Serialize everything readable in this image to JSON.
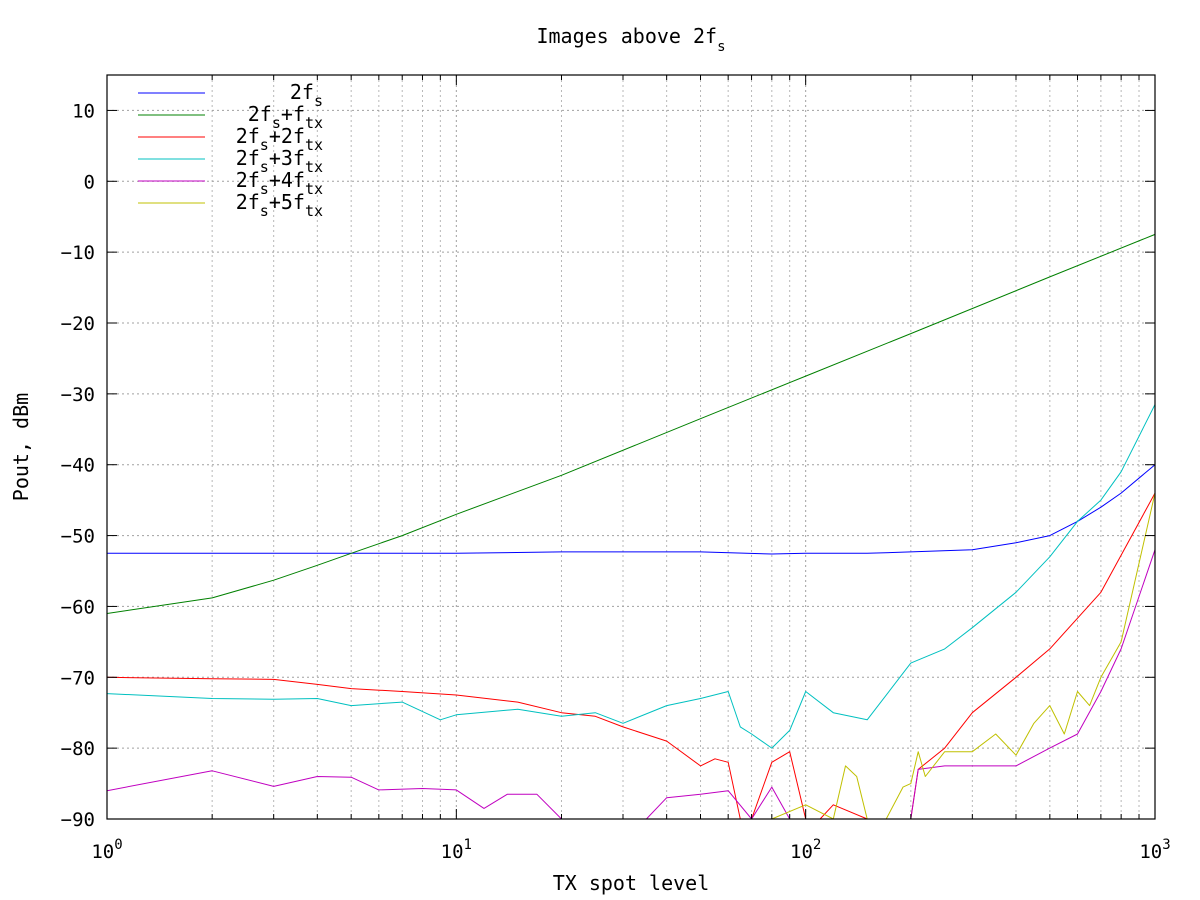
{
  "chart_data": {
    "type": "line",
    "title": {
      "base": "Images above 2f",
      "sub": "s"
    },
    "xlabel": "TX spot level",
    "ylabel": "Pout, dBm",
    "xscale": "log",
    "xlim": [
      1,
      1000
    ],
    "ylim": [
      -90,
      15
    ],
    "grid": true,
    "legend_position": "top-left",
    "x_tick_labels": [
      {
        "base": "10",
        "exp": "0",
        "value": 1
      },
      {
        "base": "10",
        "exp": "1",
        "value": 10
      },
      {
        "base": "10",
        "exp": "2",
        "value": 100
      },
      {
        "base": "10",
        "exp": "3",
        "value": 1000
      }
    ],
    "y_ticks": [
      -90,
      -80,
      -70,
      -60,
      -50,
      -40,
      -30,
      -20,
      -10,
      0,
      10
    ],
    "y_tick_labels": [
      "−90",
      "−80",
      "−70",
      "−60",
      "−50",
      "−40",
      "−30",
      "−20",
      "−10",
      "0",
      "10"
    ],
    "series": [
      {
        "legend": [
          [
            "2f",
            ""
          ],
          [
            "s",
            "sub"
          ]
        ],
        "color": "#0000ff",
        "x": [
          1,
          2,
          5,
          10,
          20,
          50,
          80,
          100,
          150,
          200,
          300,
          400,
          500,
          600,
          700,
          800,
          1000
        ],
        "y": [
          -52.5,
          -52.5,
          -52.5,
          -52.5,
          -52.3,
          -52.3,
          -52.6,
          -52.5,
          -52.5,
          -52.3,
          -52,
          -51,
          -50,
          -48,
          -46,
          -44,
          -40
        ]
      },
      {
        "legend": [
          [
            "2f",
            ""
          ],
          [
            "s",
            "sub"
          ],
          [
            "+f",
            ""
          ],
          [
            "tx",
            "sub"
          ]
        ],
        "color": "#008000",
        "x": [
          1,
          2,
          3,
          4,
          5,
          7,
          10,
          20,
          50,
          100,
          200,
          500,
          1000
        ],
        "y": [
          -61,
          -58.8,
          -56.3,
          -54.2,
          -52.5,
          -50,
          -47,
          -41.5,
          -33.5,
          -27.5,
          -21.5,
          -13.5,
          -7.5
        ]
      },
      {
        "legend": [
          [
            "2f",
            ""
          ],
          [
            "s",
            "sub"
          ],
          [
            "+2f",
            ""
          ],
          [
            "tx",
            "sub"
          ]
        ],
        "color": "#ff0000",
        "x": [
          1,
          2,
          3,
          4,
          5,
          7,
          10,
          15,
          20,
          25,
          30,
          40,
          50,
          55,
          60,
          65,
          70,
          80,
          90,
          100,
          110,
          120,
          150,
          200,
          210,
          250,
          300,
          400,
          500,
          700,
          1000
        ],
        "y": [
          -70,
          -70.2,
          -70.3,
          -71,
          -71.6,
          -72,
          -72.5,
          -73.5,
          -75,
          -75.5,
          -77,
          -79,
          -82.5,
          -81.5,
          -82,
          -90,
          -90,
          -82,
          -80.5,
          -90,
          -90,
          -88,
          -90,
          -90,
          -83,
          -80,
          -75,
          -70,
          -66,
          -58,
          -44
        ]
      },
      {
        "legend": [
          [
            "2f",
            ""
          ],
          [
            "s",
            "sub"
          ],
          [
            "+3f",
            ""
          ],
          [
            "tx",
            "sub"
          ]
        ],
        "color": "#00c0c0",
        "x": [
          1,
          2,
          3,
          4,
          5,
          7,
          9,
          10,
          15,
          20,
          25,
          30,
          40,
          50,
          60,
          65,
          70,
          80,
          90,
          100,
          120,
          150,
          200,
          250,
          300,
          400,
          500,
          600,
          700,
          800,
          1000
        ],
        "y": [
          -72.3,
          -73,
          -73.1,
          -73,
          -74,
          -73.5,
          -76,
          -75.3,
          -74.5,
          -75.5,
          -75,
          -76.5,
          -74,
          -73,
          -72,
          -77,
          -78,
          -80,
          -77.5,
          -72,
          -75,
          -76,
          -68,
          -66,
          -63,
          -58,
          -53,
          -48,
          -45,
          -41,
          -31.5
        ]
      },
      {
        "legend": [
          [
            "2f",
            ""
          ],
          [
            "s",
            "sub"
          ],
          [
            "+4f",
            ""
          ],
          [
            "tx",
            "sub"
          ]
        ],
        "color": "#c000c0",
        "x": [
          1,
          2,
          3,
          4,
          5,
          6,
          8,
          10,
          12,
          14,
          17,
          20,
          25,
          35,
          40,
          50,
          60,
          70,
          80,
          90,
          100,
          200,
          210,
          250,
          300,
          400,
          500,
          600,
          700,
          800,
          1000
        ],
        "y": [
          -86,
          -83.2,
          -85.4,
          -84,
          -84.1,
          -85.9,
          -85.7,
          -85.9,
          -88.5,
          -86.5,
          -86.5,
          -90,
          -90,
          -90,
          -87,
          -86.5,
          -86,
          -90,
          -85.5,
          -90,
          -90,
          -90,
          -83,
          -82.5,
          -82.5,
          -82.5,
          -80,
          -78,
          -72,
          -66,
          -52
        ]
      },
      {
        "legend": [
          [
            "2f",
            ""
          ],
          [
            "s",
            "sub"
          ],
          [
            "+5f",
            ""
          ],
          [
            "tx",
            "sub"
          ]
        ],
        "color": "#c0c000",
        "x": [
          80,
          100,
          120,
          130,
          140,
          150,
          170,
          190,
          200,
          210,
          220,
          250,
          300,
          350,
          400,
          450,
          500,
          550,
          600,
          650,
          700,
          800,
          1000
        ],
        "y": [
          -90,
          -88,
          -90,
          -82.5,
          -84,
          -90,
          -90,
          -85.5,
          -85,
          -80.5,
          -84,
          -80.5,
          -80.5,
          -78,
          -81,
          -76.5,
          -74,
          -78,
          -72,
          -74,
          -70,
          -65,
          -44
        ]
      }
    ]
  }
}
